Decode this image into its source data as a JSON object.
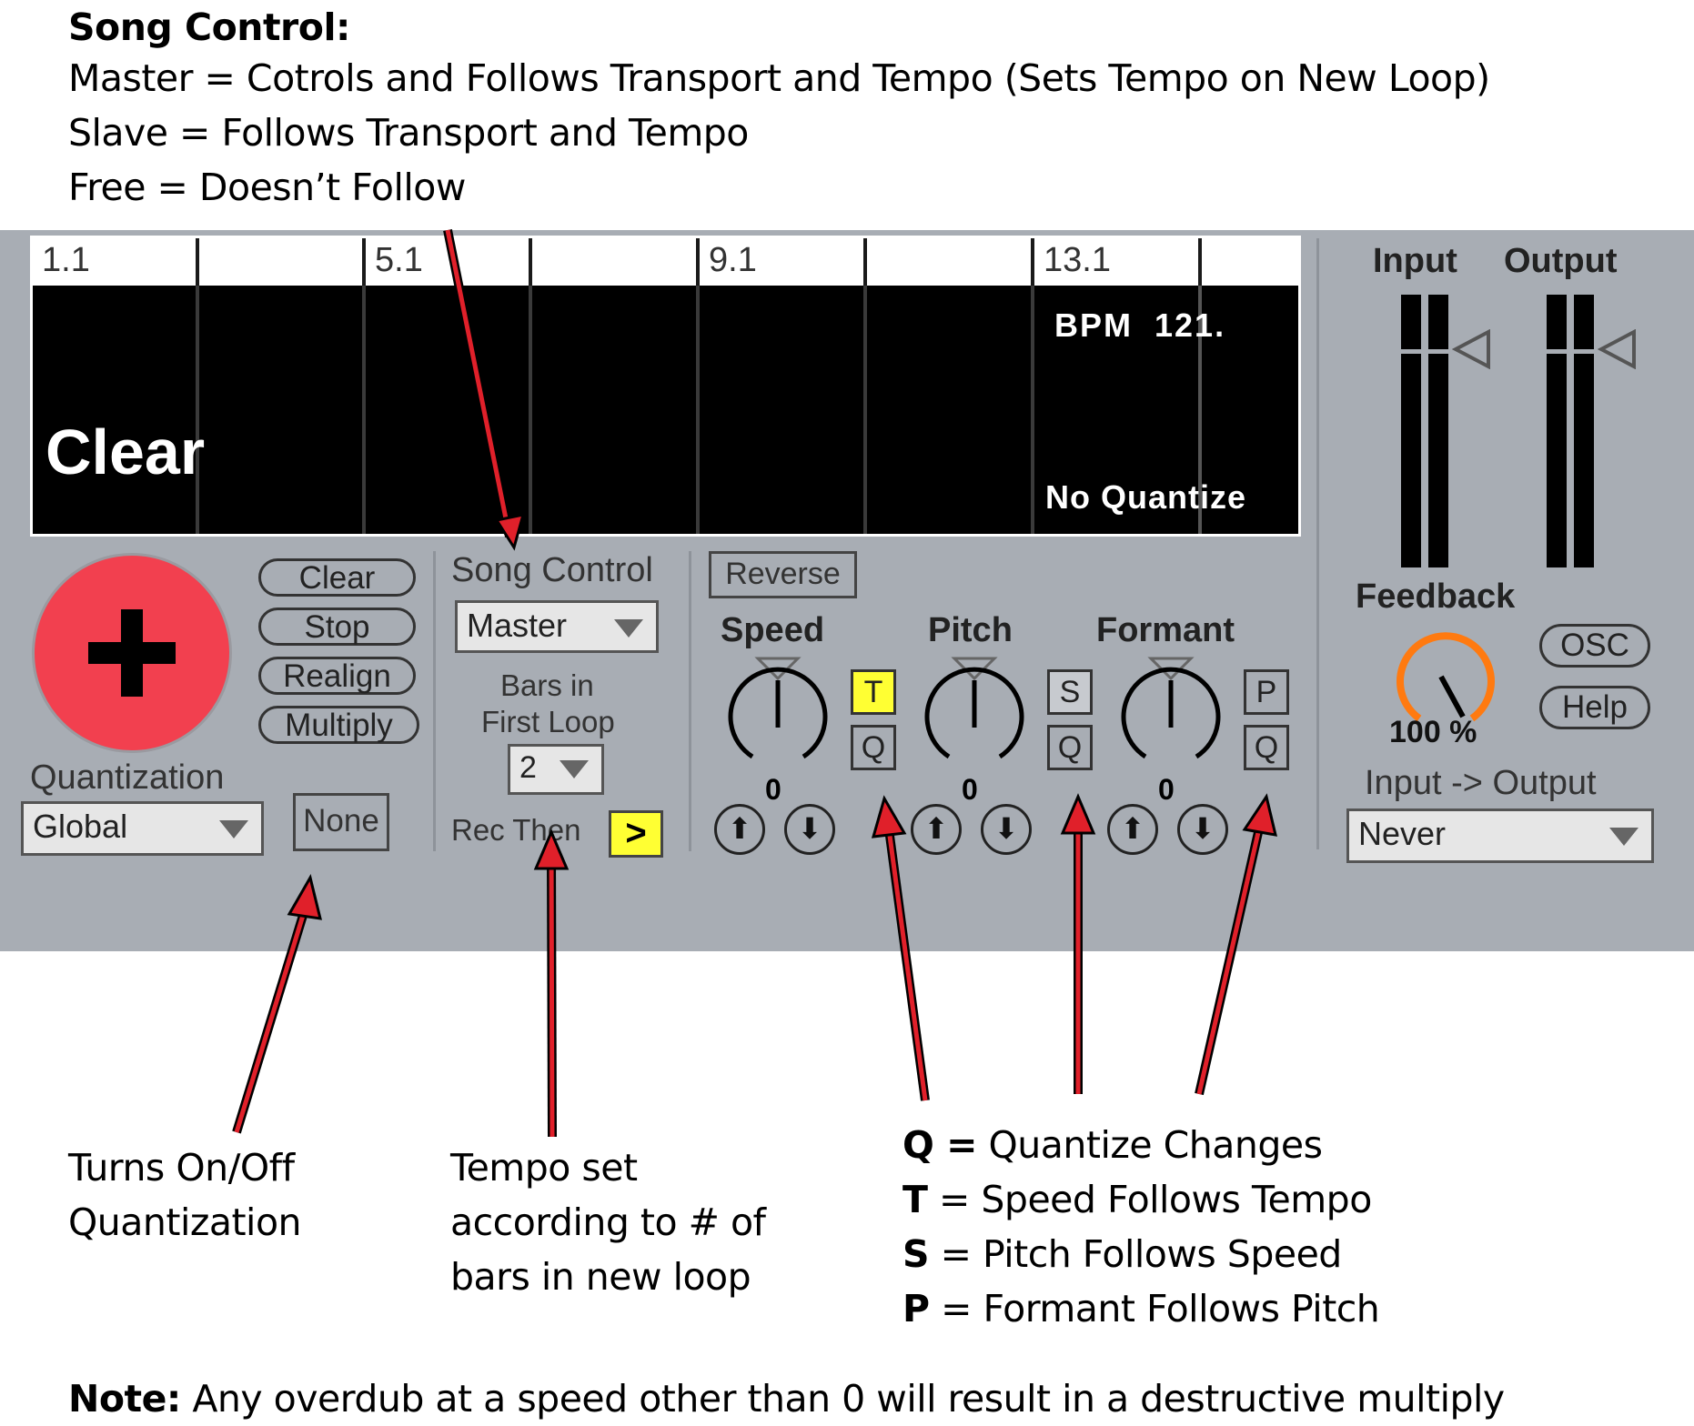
{
  "header": {
    "title": "Song Control:",
    "lines": [
      "Master = Cotrols and Follows Transport and Tempo (Sets Tempo on New Loop)",
      "Slave = Follows Transport and Tempo",
      "Free = Doesn’t Follow"
    ]
  },
  "display": {
    "ruler_labels": [
      "1.1",
      "",
      "5.1",
      "",
      "9.1",
      "",
      "13.1",
      ""
    ],
    "bpm_label": "BPM",
    "bpm_value": "121.",
    "state": "Clear",
    "quantize": "No Quantize"
  },
  "left": {
    "buttons": [
      "Clear",
      "Stop",
      "Realign",
      "Multiply"
    ],
    "quantization_label": "Quantization",
    "quantization_value": "Global",
    "none_button": "None"
  },
  "song": {
    "label": "Song Control",
    "value": "Master",
    "bars_label_1": "Bars in",
    "bars_label_2": "First Loop",
    "bars_value": "2",
    "rec_then_label": "Rec Then",
    "rec_then_value": ">"
  },
  "controls": {
    "reverse": "Reverse",
    "speed": {
      "label": "Speed",
      "value": "0",
      "toggle_top": "T",
      "toggle_bottom": "Q"
    },
    "pitch": {
      "label": "Pitch",
      "value": "0",
      "toggle_top": "S",
      "toggle_bottom": "Q"
    },
    "formant": {
      "label": "Formant",
      "value": "0",
      "toggle_top": "P",
      "toggle_bottom": "Q"
    },
    "up_icon": "⬆",
    "down_icon": "⬇"
  },
  "right": {
    "input_label": "Input",
    "output_label": "Output",
    "feedback_label": "Feedback",
    "feedback_value": "100 %",
    "feedback_fraction": 1.0,
    "osc_button": "OSC",
    "help_button": "Help",
    "io_label": "Input -> Output",
    "io_value": "Never"
  },
  "annotations": {
    "quantization": [
      "Turns On/Off",
      "Quantization"
    ],
    "tempo": [
      "Tempo set",
      "according to # of",
      "bars in new loop"
    ],
    "legend": [
      {
        "key": "Q =",
        "text": " Quantize Changes"
      },
      {
        "key": "T",
        "text": " = Speed Follows Tempo"
      },
      {
        "key": "S",
        "text": " = Pitch Follows Speed"
      },
      {
        "key": "P",
        "text": " = Formant Follows Pitch"
      }
    ],
    "note_key": "Note:",
    "note_text": " Any overdub at a speed other than 0 will result in a destructive multiply"
  },
  "colors": {
    "panel": "#a8adb4",
    "record_button": "#f2404f",
    "highlight": "#ffff33",
    "feedback_ring": "#ff7a10",
    "arrow": "#e0202a"
  }
}
